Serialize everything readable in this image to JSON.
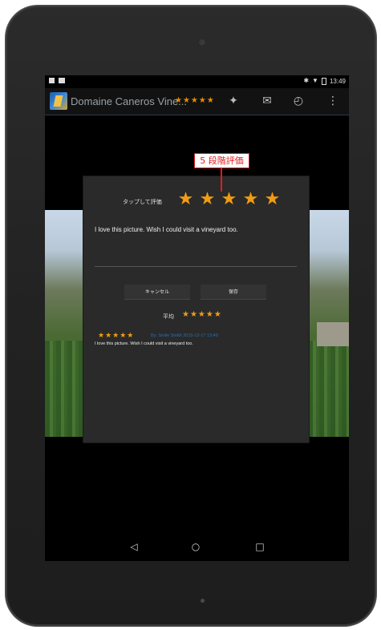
{
  "status_bar": {
    "time": "13:49",
    "bluetooth_icon": "bluetooth-icon",
    "wifi_icon": "wifi-icon",
    "battery_icon": "battery-icon"
  },
  "action_bar": {
    "title": "Domaine Caneros Vine...",
    "rating_stars": "★★★★★",
    "icons": [
      "magic-wand-icon",
      "mail-icon",
      "history-icon",
      "overflow-menu-icon"
    ]
  },
  "dialog": {
    "tap_label": "タップして評価",
    "rating": 5,
    "rating_max": 5,
    "comment": "I love this picture. Wish I could visit a vineyard too.",
    "cancel_label": "キャンセル",
    "save_label": "保存",
    "average_label": "平均",
    "average_stars": "★★★★★",
    "review": {
      "stars": "★★★★★",
      "meta": "By: Smile Smith  2015-12-17 13:49",
      "text": "I love this picture. Wish I could visit a vineyard too."
    }
  },
  "annotation": {
    "label": "5 段階評価"
  },
  "colors": {
    "star": "#f39c12",
    "annotation": "#e21b1b",
    "link": "#2a6fb0"
  }
}
